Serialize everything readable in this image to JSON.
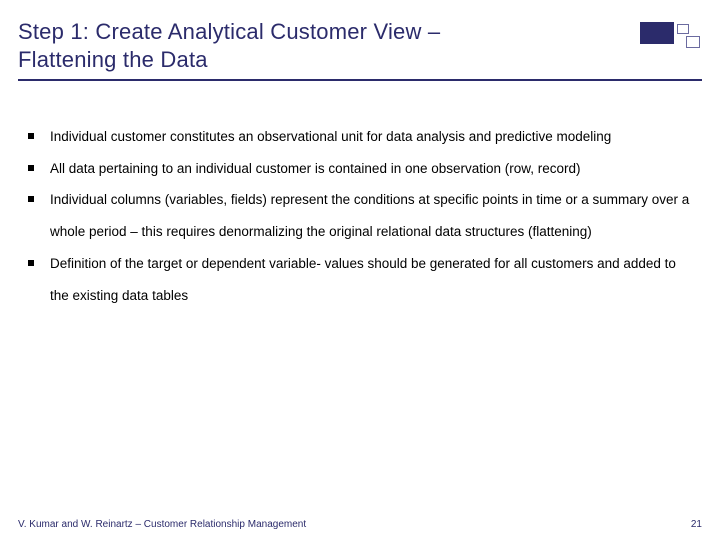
{
  "title": "Step 1: Create Analytical Customer View – Flattening the Data",
  "bullets": [
    "Individual customer constitutes an observational unit for data analysis and predictive modeling",
    "All data pertaining to an individual customer is contained in one observation (row, record)",
    "Individual columns (variables, fields) represent the conditions at specific points in time or a summary over a whole period – this requires denormalizing the original relational data structures (flattening)",
    "Definition of the target or dependent variable-  values should be generated for all customers and added to the existing data tables"
  ],
  "footer": {
    "credit": "V. Kumar and W. Reinartz – Customer Relationship Management",
    "page": "21"
  }
}
